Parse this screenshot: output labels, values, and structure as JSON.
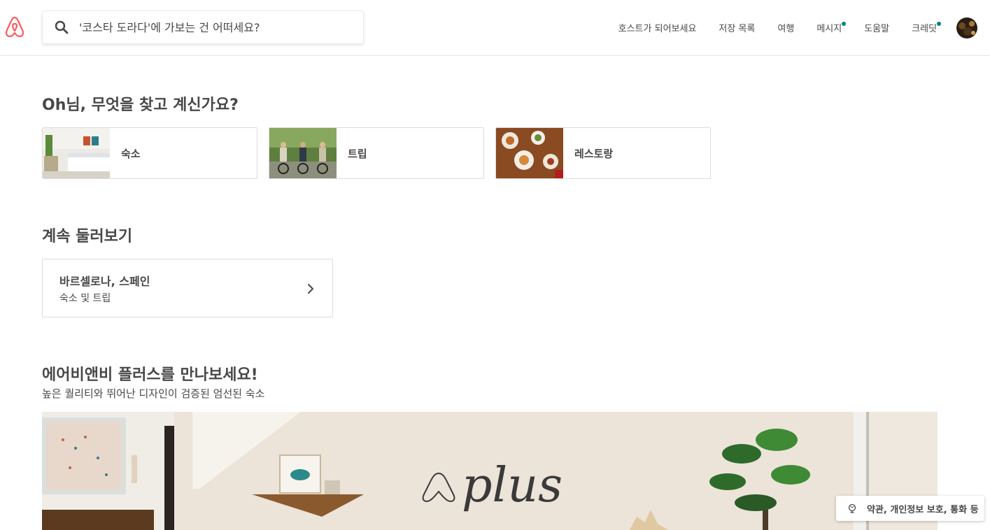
{
  "header": {
    "logo_icon": "airbnb-logo-icon",
    "brand_color": "#FF5A5F",
    "search": {
      "placeholder": "'코스타 도라다'에 가보는 건 어떠세요?",
      "icon": "search-icon"
    },
    "nav": [
      {
        "label": "호스트가 되어보세요",
        "dot": false
      },
      {
        "label": "저장 목록",
        "dot": false
      },
      {
        "label": "여행",
        "dot": false
      },
      {
        "label": "메시지",
        "dot": true
      },
      {
        "label": "도움말",
        "dot": false
      },
      {
        "label": "크레딧",
        "dot": true
      }
    ],
    "notification_dot_color": "#00838A",
    "avatar_icon": "user-avatar"
  },
  "greeting": {
    "title": "Oh님, 무엇을 찾고 계신가요?"
  },
  "categories": [
    {
      "label": "숙소",
      "icon": "homes-photo"
    },
    {
      "label": "트립",
      "icon": "experiences-photo"
    },
    {
      "label": "레스토랑",
      "icon": "restaurants-photo"
    }
  ],
  "continue_browsing": {
    "title": "계속 둘러보기",
    "item": {
      "title": "바르셀로나, 스페인",
      "subtitle": "숙소 및 트립",
      "icon": "chevron-right-icon"
    }
  },
  "plus": {
    "title": "에어비앤비 플러스를 만나보세요!",
    "subtitle": "높은 퀄리티와 뛰어난 디자인이 검증된 엄선된 숙소",
    "banner_text": "plus"
  },
  "footer": {
    "label": "약관, 개인정보 보호, 통화 등",
    "icon": "globe-icon"
  }
}
